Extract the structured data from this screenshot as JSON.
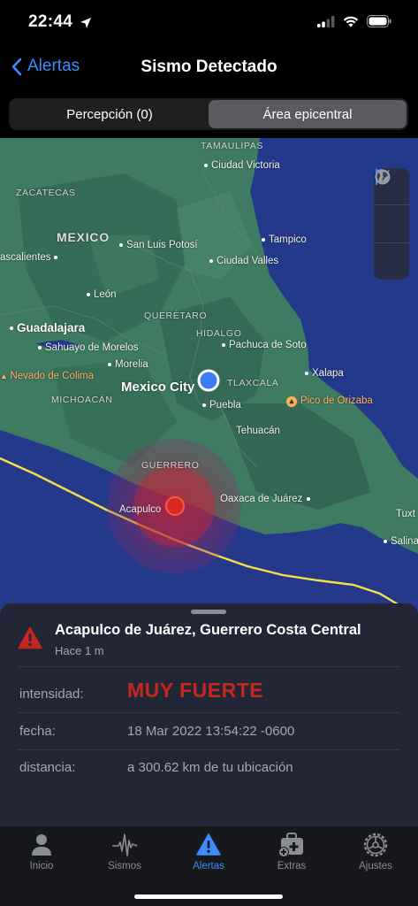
{
  "status_bar": {
    "time": "22:44"
  },
  "nav": {
    "back_label": "Alertas",
    "title": "Sismo Detectado"
  },
  "segments": [
    {
      "label": "Percepción (0)",
      "active": false
    },
    {
      "label": "Área epicentral",
      "active": true
    }
  ],
  "map": {
    "labels": {
      "tamaulipas": "TAMAULIPAS",
      "zacatecas": "ZACATECAS",
      "mexico": "MEXICO",
      "queretaro": "QUERÉTARO",
      "hidalgo": "HIDALGO",
      "michoacan": "MICHOACÁN",
      "tlaxcala": "TLAXCALA",
      "guerrero": "GUERRERO",
      "ciudad_victoria": "Ciudad Victoria",
      "san_luis_potosi": "San Luis Potosí",
      "tampico": "Tampico",
      "ascalientes": "ascalientes",
      "ciudad_valles": "Ciudad Valles",
      "leon": "León",
      "guadalajara": "Guadalajara",
      "sahuayo": "Sahuayo de Morelos",
      "pachuca": "Pachuca de Soto",
      "morelia": "Morelia",
      "nevado": "Nevado de Colima",
      "xalapa": "Xalapa",
      "mexico_city": "Mexico City",
      "puebla": "Puebla",
      "pico": "Pico de Orizaba",
      "tehuacan": "Tehuacán",
      "oaxaca": "Oaxaca de Juárez",
      "acapulco": "Acapulco",
      "tuxt": "Tuxt",
      "salina": "Salina"
    },
    "tools": [
      "location-arrow-icon",
      "flag-icon",
      "globe-icon"
    ],
    "colors": {
      "water": "#24398a",
      "land": "#3f7a62",
      "fault_line": "#f1e24a",
      "epicenter": "#d8281f",
      "user_location": "#3b7cf6"
    }
  },
  "alert": {
    "title": "Acapulco de Juárez, Guerrero Costa Central",
    "time_ago": "Hace 1 m",
    "rows": [
      {
        "label": "intensidad:",
        "value": "MUY FUERTE",
        "style": "danger"
      },
      {
        "label": "fecha:",
        "value": "18 Mar 2022 13:54:22 -0600"
      },
      {
        "label": "distancia:",
        "value": "a 300.62 km de tu ubicación"
      }
    ],
    "danger_color": "#c3271e"
  },
  "tabs": [
    {
      "label": "Inicio",
      "icon": "person-icon",
      "active": false
    },
    {
      "label": "Sismos",
      "icon": "waveform-icon",
      "active": false
    },
    {
      "label": "Alertas",
      "icon": "warning-triangle-icon",
      "active": true
    },
    {
      "label": "Extras",
      "icon": "first-aid-kit-icon",
      "active": false
    },
    {
      "label": "Ajustes",
      "icon": "gear-icon",
      "active": false
    }
  ]
}
